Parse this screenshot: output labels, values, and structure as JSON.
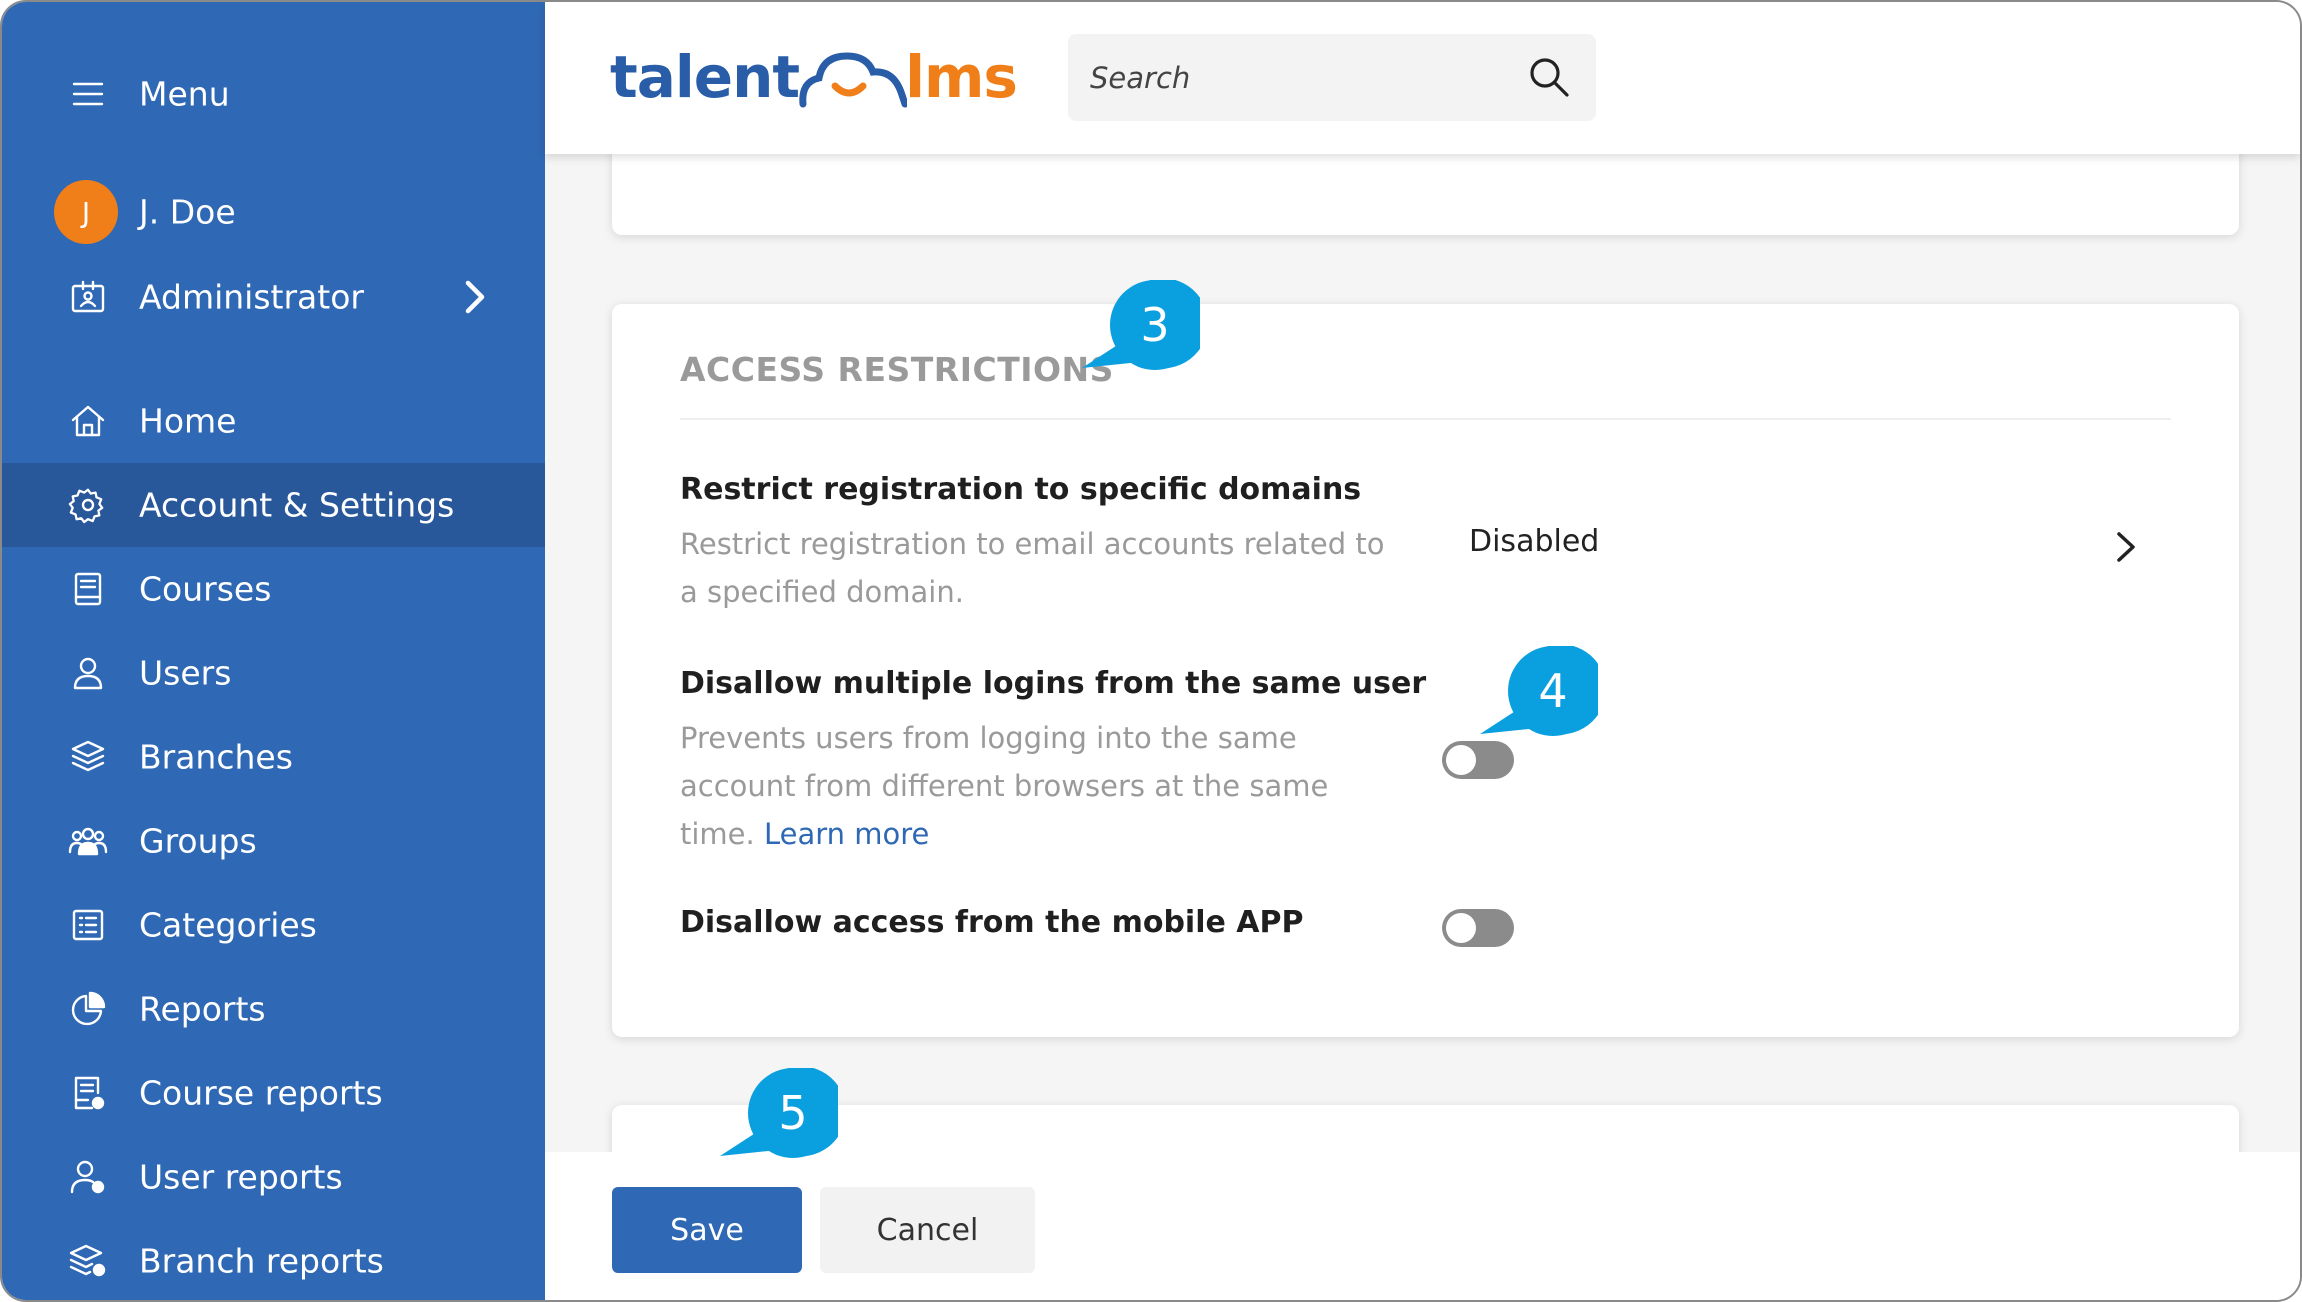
{
  "sidebar": {
    "menu_label": "Menu",
    "user": {
      "initial": "J",
      "name": "J. Doe"
    },
    "role": "Administrator",
    "items": [
      {
        "label": "Home",
        "icon": "home-icon"
      },
      {
        "label": "Account & Settings",
        "icon": "gear-icon",
        "active": true
      },
      {
        "label": "Courses",
        "icon": "book-icon"
      },
      {
        "label": "Users",
        "icon": "user-icon"
      },
      {
        "label": "Branches",
        "icon": "layers-icon"
      },
      {
        "label": "Groups",
        "icon": "group-icon"
      },
      {
        "label": "Categories",
        "icon": "list-icon"
      },
      {
        "label": "Reports",
        "icon": "pie-chart-icon"
      },
      {
        "label": "Course reports",
        "icon": "course-report-icon"
      },
      {
        "label": "User reports",
        "icon": "user-report-icon"
      },
      {
        "label": "Branch reports",
        "icon": "branch-report-icon"
      }
    ]
  },
  "header": {
    "logo": {
      "part1": "talent",
      "part2": "lms"
    },
    "search_placeholder": "Search"
  },
  "section": {
    "title": "ACCESS RESTRICTIONS",
    "settings": [
      {
        "title": "Restrict registration to specific domains",
        "description": "Restrict registration to email accounts related to a specified domain.",
        "value": "Disabled"
      },
      {
        "title": "Disallow multiple logins from the same user",
        "description": "Prevents users from logging into the same account from different browsers at the same time.",
        "link": "Learn more",
        "enabled": false
      },
      {
        "title": "Disallow access from the mobile APP",
        "enabled": false
      }
    ]
  },
  "footer": {
    "save_label": "Save",
    "cancel_label": "Cancel"
  },
  "callouts": [
    "3",
    "4",
    "5"
  ],
  "colors": {
    "sidebar": "#2f68b4",
    "sidebar_active": "#28579a",
    "accent_orange": "#f07f1a",
    "callout": "#0aa0e0",
    "toggle_off": "#8b8b8b"
  }
}
